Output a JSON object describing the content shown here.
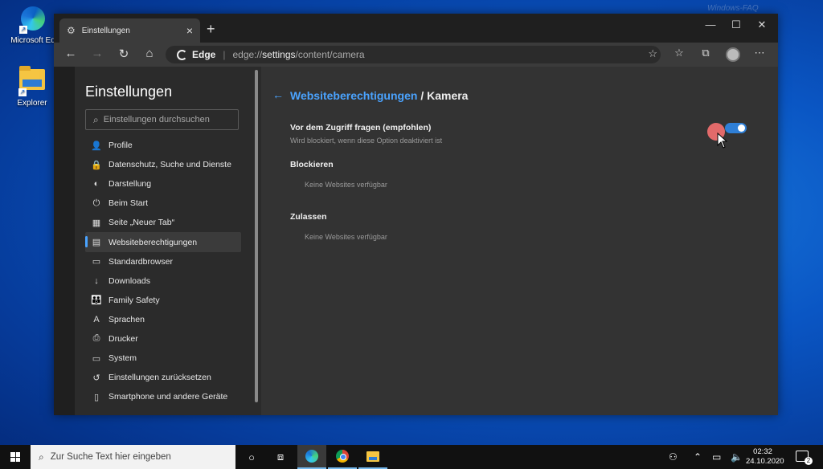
{
  "desktop": {
    "icons": [
      {
        "label": "Microsoft Ed"
      },
      {
        "label": "Explorer"
      }
    ],
    "watermark": "Windows-FAQ"
  },
  "browser": {
    "tab_title": "Einstellungen",
    "address": {
      "brand": "Edge",
      "url_prefix": "edge://",
      "url_host": "settings",
      "url_path": "/content/camera"
    }
  },
  "sidebar": {
    "title": "Einstellungen",
    "search_placeholder": "Einstellungen durchsuchen",
    "items": [
      {
        "label": "Profile",
        "icon": "profile-icon",
        "glyph": "👤"
      },
      {
        "label": "Datenschutz, Suche und Dienste",
        "icon": "lock-icon",
        "glyph": "🔒"
      },
      {
        "label": "Darstellung",
        "icon": "appearance-icon",
        "glyph": "◐"
      },
      {
        "label": "Beim Start",
        "icon": "power-icon",
        "glyph": "⏻"
      },
      {
        "label": "Seite „Neuer Tab“",
        "icon": "newtab-icon",
        "glyph": "▦"
      },
      {
        "label": "Websiteberechtigungen",
        "icon": "site-permissions-icon",
        "glyph": "▤"
      },
      {
        "label": "Standardbrowser",
        "icon": "browser-icon",
        "glyph": "▭"
      },
      {
        "label": "Downloads",
        "icon": "download-icon",
        "glyph": "↓"
      },
      {
        "label": "Family Safety",
        "icon": "family-icon",
        "glyph": "👪"
      },
      {
        "label": "Sprachen",
        "icon": "language-icon",
        "glyph": "A"
      },
      {
        "label": "Drucker",
        "icon": "printer-icon",
        "glyph": "⎙"
      },
      {
        "label": "System",
        "icon": "system-icon",
        "glyph": "▭"
      },
      {
        "label": "Einstellungen zurücksetzen",
        "icon": "reset-icon",
        "glyph": "↺"
      },
      {
        "label": "Smartphone und andere Geräte",
        "icon": "phone-icon",
        "glyph": "▯"
      }
    ]
  },
  "main": {
    "breadcrumb_link": "Websiteberechtigungen",
    "breadcrumb_current": "/ Kamera",
    "ask_title": "Vor dem Zugriff fragen (empfohlen)",
    "ask_subtitle": "Wird blockiert, wenn diese Option deaktiviert ist",
    "ask_enabled": true,
    "block_title": "Blockieren",
    "block_empty": "Keine Websites verfügbar",
    "allow_title": "Zulassen",
    "allow_empty": "Keine Websites verfügbar"
  },
  "taskbar": {
    "search_placeholder": "Zur Suche Text hier eingeben",
    "time": "02:32",
    "date": "24.10.2020",
    "notification_count": "2"
  },
  "colors": {
    "accent": "#4aa3ff",
    "toggle_on": "#2f7fd6",
    "taskbar": "#111111"
  }
}
